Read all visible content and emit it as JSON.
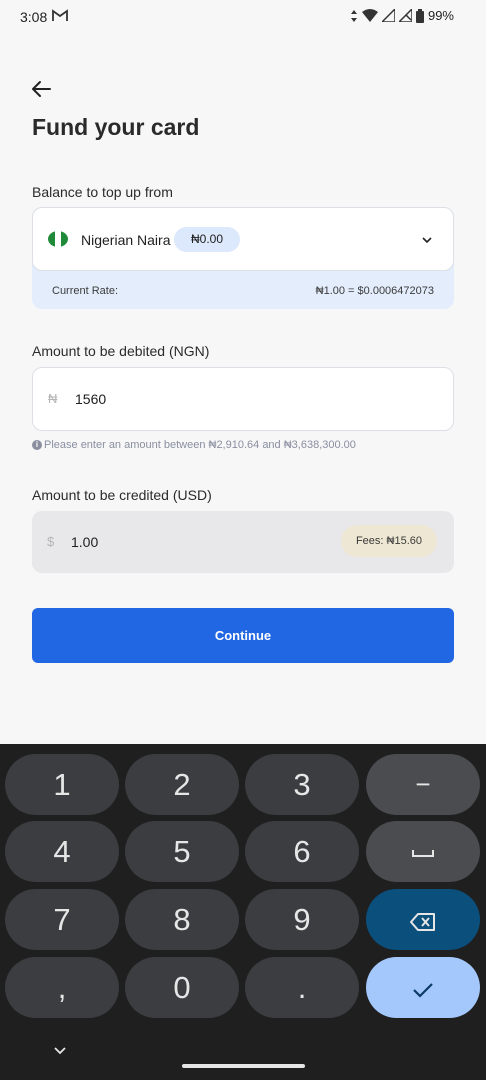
{
  "status_bar": {
    "time": "3:08",
    "battery": "99%"
  },
  "header": {
    "title": "Fund your card"
  },
  "balance": {
    "label": "Balance to top up from",
    "currency_name": "Nigerian Naira",
    "balance_amount": "₦0.00",
    "rate_label": "Current Rate:",
    "rate_value": "₦1.00 = $0.0006472073",
    "flag_colors": [
      "#1f8a3a",
      "#ffffff",
      "#1f8a3a"
    ]
  },
  "debit": {
    "label": "Amount to be debited (NGN)",
    "prefix": "₦",
    "value": "1560",
    "hint": "Please enter an amount between ₦2,910.64 and ₦3,638,300.00"
  },
  "credit": {
    "label": "Amount to be credited (USD)",
    "prefix": "$",
    "value": "1.00",
    "fees": "Fees: ₦15.60"
  },
  "continue_label": "Continue",
  "keyboard": {
    "keys": [
      "1",
      "2",
      "3",
      "−",
      "4",
      "5",
      "6",
      "␣",
      "7",
      "8",
      "9",
      "backspace",
      ",",
      "0",
      ".",
      "done"
    ]
  },
  "colors": {
    "primary": "#2166e2",
    "rate_bg": "#e3edfc"
  }
}
